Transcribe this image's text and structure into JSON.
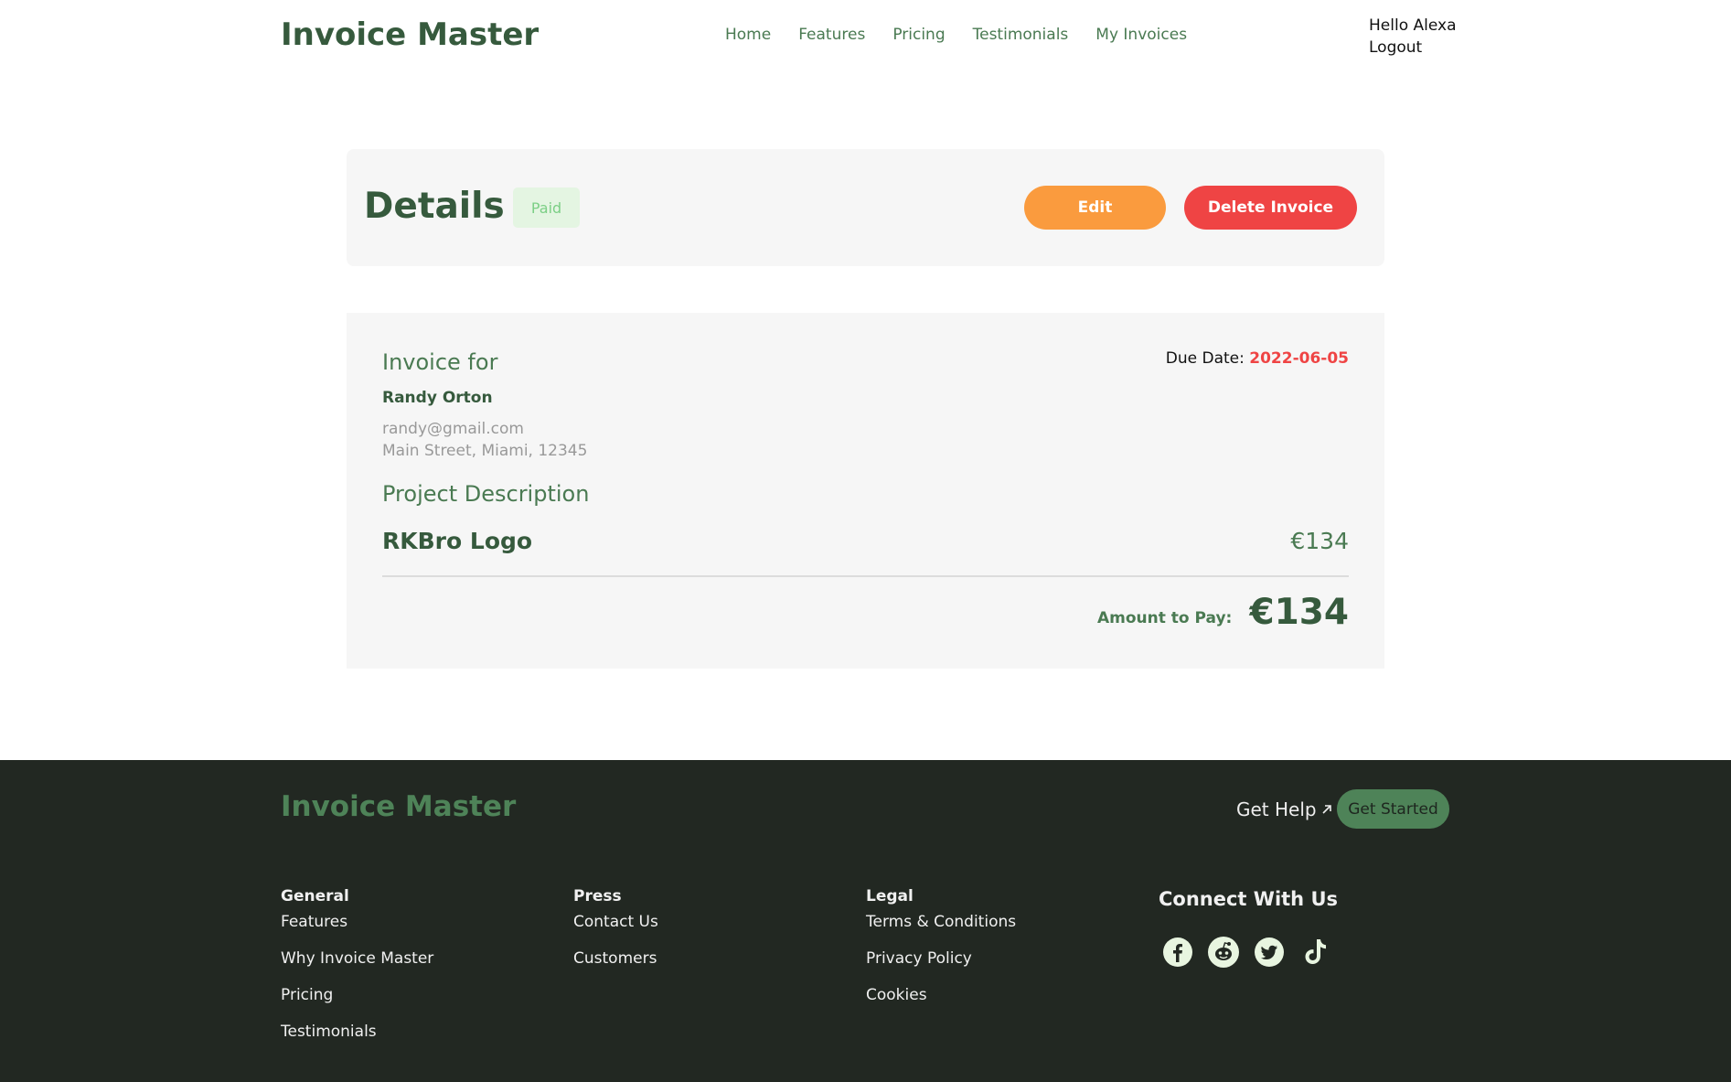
{
  "header": {
    "brand": "Invoice Master",
    "nav": [
      "Home",
      "Features",
      "Pricing",
      "Testimonials",
      "My Invoices"
    ],
    "greeting": "Hello Alexa",
    "logout": "Logout"
  },
  "details": {
    "title": "Details",
    "status": "Paid",
    "edit_label": "Edit",
    "delete_label": "Delete Invoice"
  },
  "invoice": {
    "for_label": "Invoice for",
    "client_name": "Randy Orton",
    "client_email": "randy@gmail.com",
    "client_address": "Main Street, Miami, 12345",
    "due_label": "Due Date:",
    "due_date": "2022-06-05",
    "project_label": "Project Description",
    "item_name": "RKBro Logo",
    "item_price": "€134",
    "amount_label": "Amount to Pay:",
    "amount": "€134"
  },
  "footer": {
    "brand": "Invoice Master",
    "get_help": "Get Help",
    "get_started": "Get Started",
    "general": {
      "title": "General",
      "links": [
        "Features",
        "Why Invoice Master",
        "Pricing",
        "Testimonials"
      ]
    },
    "press": {
      "title": "Press",
      "links": [
        "Contact Us",
        "Customers"
      ]
    },
    "legal": {
      "title": "Legal",
      "links": [
        "Terms & Conditions",
        "Privacy Policy",
        "Cookies"
      ]
    },
    "connect_title": "Connect With Us",
    "socials": [
      "facebook-icon",
      "reddit-icon",
      "twitter-icon",
      "tiktok-icon"
    ]
  },
  "colors": {
    "brand_green": "#365a3d",
    "accent_green": "#4e8358",
    "edit_orange": "#fa9b3e",
    "delete_red": "#ef4444",
    "footer_bg": "#222822"
  }
}
